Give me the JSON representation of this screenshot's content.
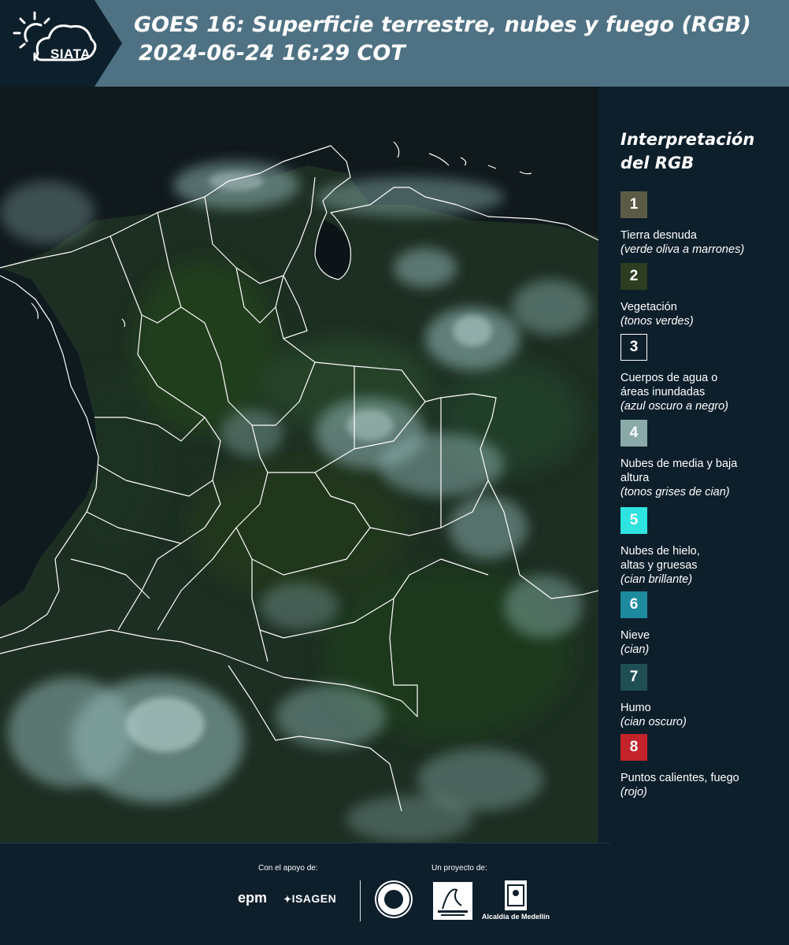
{
  "header": {
    "logo_text": "SIATA",
    "title_line1": "GOES 16: Superficie terrestre, nubes y fuego (RGB)",
    "title_line2": "2024-06-24 16:29 COT",
    "band_color": "#4e7283"
  },
  "legend": {
    "title": "Interpretación del RGB",
    "items": [
      {
        "number": "1",
        "label": "Tierra desnuda",
        "hint": "(verde oliva a marrones)",
        "color": "#5b5b45"
      },
      {
        "number": "2",
        "label": "Vegetación",
        "hint": "(tonos verdes)",
        "color": "#2c3d20"
      },
      {
        "number": "3",
        "label": "Cuerpos de agua o áreas inundadas",
        "hint": "(azul oscuro a negro)",
        "color": "#0d1f2b"
      },
      {
        "number": "4",
        "label": "Nubes de media y baja altura",
        "hint": "(tonos grises de cian)",
        "color": "#8aaaa9"
      },
      {
        "number": "5",
        "label": "Nubes de hielo, altas y gruesas",
        "hint": "(cian brillante)",
        "color": "#2ee3e0"
      },
      {
        "number": "6",
        "label": "Nieve",
        "hint": "(cian)",
        "color": "#1e8a9d"
      },
      {
        "number": "7",
        "label": "Humo",
        "hint": "(cian oscuro)",
        "color": "#1f4f55"
      },
      {
        "number": "8",
        "label": "Puntos calientes, fuego",
        "hint": "(rojo)",
        "color": "#c3242b"
      }
    ]
  },
  "footer": {
    "support_label": "Con el apoyo de:",
    "project_label": "Un proyecto de:",
    "sponsor_1": "epm",
    "sponsor_2": "ISAGEN",
    "partner_3": "Alcaldía de Medellín"
  }
}
